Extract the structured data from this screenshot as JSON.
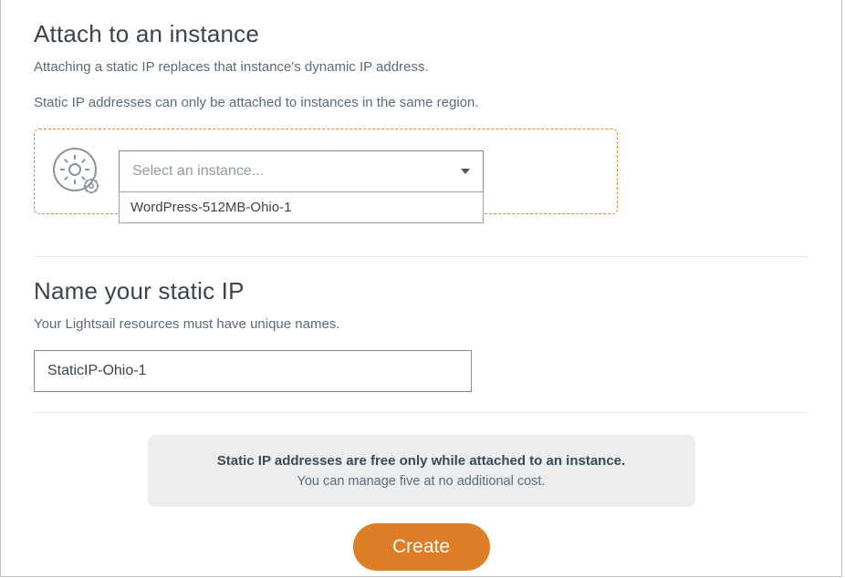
{
  "attach": {
    "title": "Attach to an instance",
    "desc1": "Attaching a static IP replaces that instance's dynamic IP address.",
    "desc2": "Static IP addresses can only be attached to instances in the same region.",
    "select_placeholder": "Select an instance...",
    "options": [
      "WordPress-512MB-Ohio-1"
    ]
  },
  "name": {
    "title": "Name your static IP",
    "desc": "Your Lightsail resources must have unique names.",
    "value": "StaticIP-Ohio-1"
  },
  "info": {
    "bold": "Static IP addresses are free only while attached to an instance.",
    "sub": "You can manage five at no additional cost."
  },
  "actions": {
    "create": "Create"
  }
}
